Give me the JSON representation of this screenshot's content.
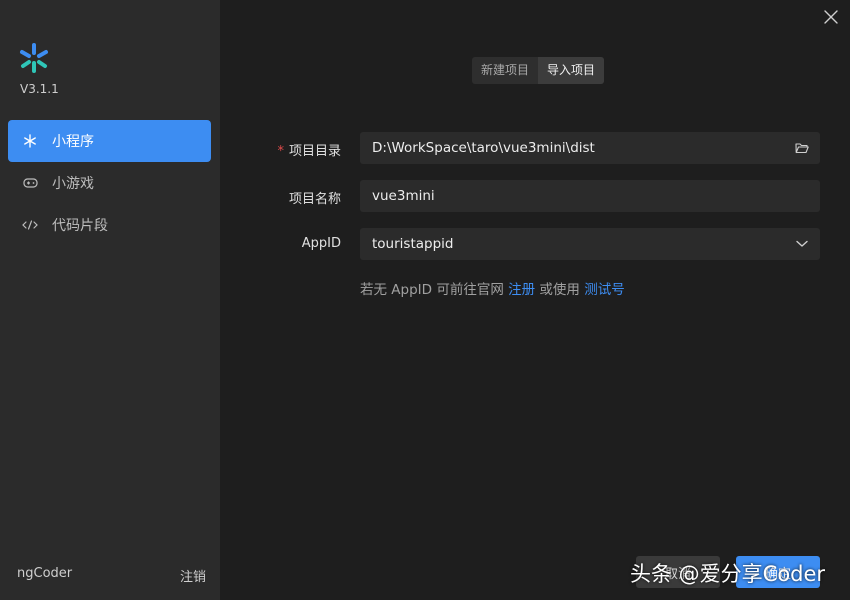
{
  "sidebar": {
    "version": "V3.1.1",
    "items": [
      {
        "label": "小程序",
        "icon": "asterisk-icon",
        "active": true
      },
      {
        "label": "小游戏",
        "icon": "gamepad-icon",
        "active": false
      },
      {
        "label": "代码片段",
        "icon": "code-icon",
        "active": false
      }
    ],
    "user": "ngCoder",
    "logout_label": "注销"
  },
  "tabs": [
    {
      "label": "新建项目",
      "active": false
    },
    {
      "label": "导入项目",
      "active": true
    }
  ],
  "form": {
    "project_dir": {
      "required_mark": "*",
      "label": "项目目录",
      "value": "D:\\WorkSpace\\taro\\vue3mini\\dist"
    },
    "project_name": {
      "label": "项目名称",
      "value": "vue3mini"
    },
    "appid": {
      "label": "AppID",
      "value": "touristappid"
    },
    "hint": {
      "prefix": "若无 AppID 可前往官网 ",
      "register_link": "注册",
      "middle": " 或使用 ",
      "test_link": "测试号"
    }
  },
  "buttons": {
    "cancel": "取消",
    "confirm": "确定"
  },
  "watermark": "头条 @爱分享Coder",
  "colors": {
    "accent": "#3d8df2",
    "sidebar_bg": "#2b2b2b",
    "main_bg": "#1e1e1e",
    "required": "#e24b4b"
  }
}
